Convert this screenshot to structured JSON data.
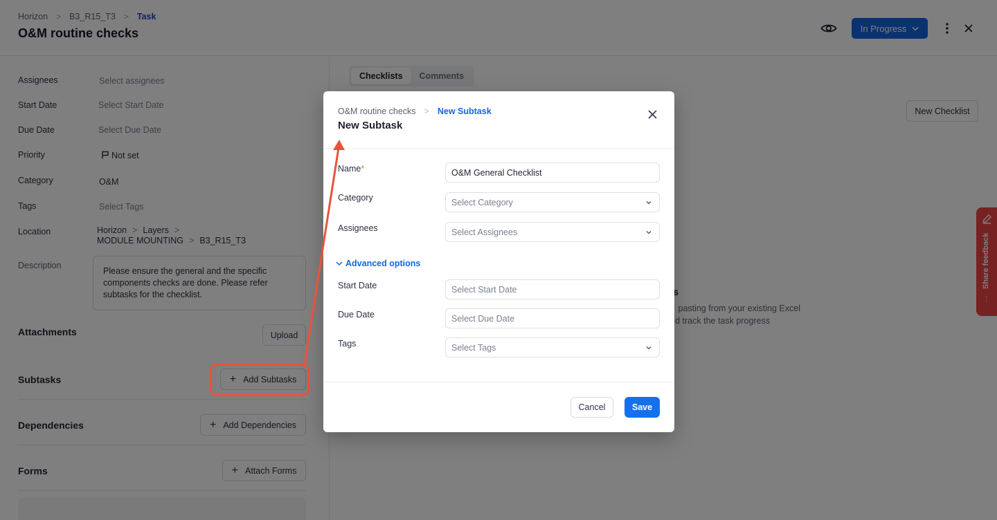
{
  "header": {
    "breadcrumb": [
      "Horizon",
      "B3_R15_T3",
      "Task"
    ],
    "title": "O&M routine checks",
    "status_label": "In Progress",
    "icons": {
      "watch": "eye-icon",
      "more": "kebab-icon",
      "close": "close-icon"
    }
  },
  "details": {
    "assignees": {
      "label": "Assignees",
      "value": "Select assignees"
    },
    "start_date": {
      "label": "Start Date",
      "value": "Select Start Date"
    },
    "due_date": {
      "label": "Due Date",
      "value": "Select Due Date"
    },
    "priority": {
      "label": "Priority",
      "value": "Not set"
    },
    "category": {
      "label": "Category",
      "value": "O&M"
    },
    "tags": {
      "label": "Tags",
      "value": "Select Tags"
    },
    "location": {
      "label": "Location",
      "line1": [
        "Horizon",
        "Layers"
      ],
      "line2": [
        "MODULE MOUNTING",
        "B3_R15_T3"
      ]
    },
    "description": {
      "label": "Description",
      "value": "Please ensure the general and the specific components checks are done. Please refer subtasks for the checklist."
    }
  },
  "sections": {
    "attachments": {
      "title": "Attachments",
      "button": "Upload"
    },
    "subtasks": {
      "title": "Subtasks",
      "button": "Add Subtasks"
    },
    "dependencies": {
      "title": "Dependencies",
      "button": "Add Dependencies"
    },
    "forms": {
      "title": "Forms",
      "button": "Attach Forms"
    }
  },
  "right": {
    "tabs": [
      {
        "label": "Checklists",
        "active": true
      },
      {
        "label": "Comments",
        "active": false
      }
    ],
    "new_checklist_label": "New Checklist",
    "empty_title": "lists",
    "empty_line1": "pasting from your existing Excel",
    "empty_line2": "d track the task progress"
  },
  "feedback": {
    "label": "Share feedback"
  },
  "modal": {
    "breadcrumb": [
      "O&M routine checks",
      "New Subtask"
    ],
    "title": "New Subtask",
    "fields": {
      "name": {
        "label": "Name",
        "required_mark": "*",
        "value": "O&M General Checklist"
      },
      "category": {
        "label": "Category",
        "placeholder": "Select Category"
      },
      "assignees": {
        "label": "Assignees",
        "placeholder": "Select Assignees"
      },
      "start_date": {
        "label": "Start Date",
        "placeholder": "Select Start Date"
      },
      "due_date": {
        "label": "Due Date",
        "placeholder": "Select Due Date"
      },
      "tags": {
        "label": "Tags",
        "placeholder": "Select Tags"
      }
    },
    "advanced_label": "Advanced options",
    "cancel_label": "Cancel",
    "save_label": "Save"
  },
  "colors": {
    "primary": "#1570ef",
    "status": "#1565e0",
    "annotation": "#e8533e",
    "feedback": "#ef4444"
  }
}
